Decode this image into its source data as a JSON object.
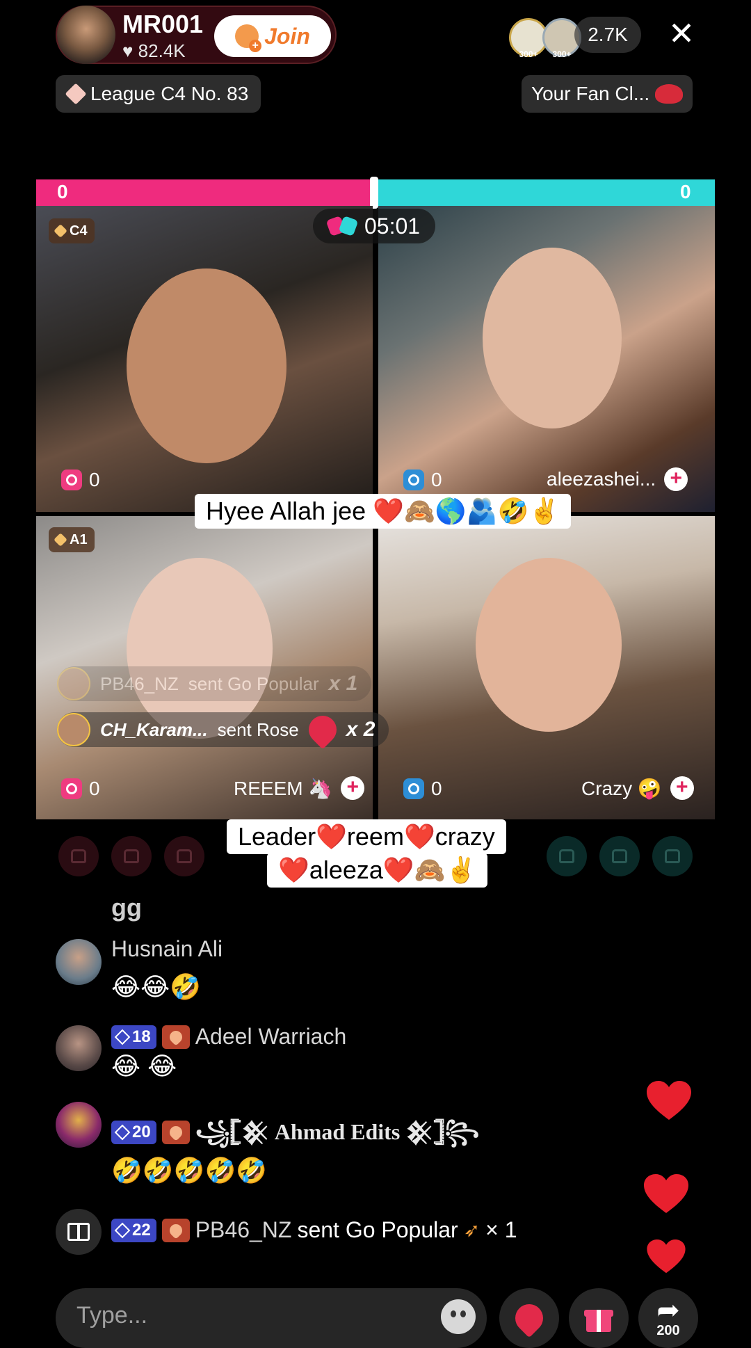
{
  "host": {
    "name": "MR001",
    "likes": "82.4K",
    "join_label": "Join"
  },
  "viewers": {
    "badge1": "300+",
    "badge2": "300+",
    "count": "2.7K"
  },
  "league": {
    "label": "League C4 No. 83"
  },
  "fan_club": {
    "label": "Your Fan Cl..."
  },
  "battle": {
    "score_left": "0",
    "score_right": "0",
    "timer": "05:01"
  },
  "tiles": [
    {
      "rank": "C4",
      "count": "0",
      "name": ""
    },
    {
      "rank": "",
      "count": "0",
      "name": "aleezashei..."
    },
    {
      "rank": "A1",
      "count": "0",
      "name": "REEEM 🦄"
    },
    {
      "rank": "",
      "count": "0",
      "name": "Crazy 🤪"
    }
  ],
  "gift_notes": [
    {
      "user": "PB46_NZ",
      "text": "sent Go Popular",
      "combo": "x 1"
    },
    {
      "user": "CH_Karam...",
      "text": "sent Rose",
      "combo": "x 2"
    }
  ],
  "captions": {
    "top": "Hyee Allah jee ❤️🙈🌎🫂🤣✌️",
    "middle_line1": "Leader❤️reem❤️crazy",
    "middle_line2": "❤️aleeza❤️🙈✌️"
  },
  "chat": {
    "partial": "gg",
    "messages": [
      {
        "name": "Husnain Ali",
        "text": "😂😂🤣"
      },
      {
        "level": "18",
        "name": "Adeel Warriach",
        "text": "😂 😂"
      },
      {
        "level": "20",
        "name": "꧁𓊈𒆜 Ahmad Edits 𒆜𓊉꧂",
        "text": "🤣🤣🤣🤣🤣"
      },
      {
        "level": "22",
        "name": "PB46_NZ",
        "text": "sent Go Popular",
        "combo": "× 1"
      }
    ]
  },
  "input": {
    "placeholder": "Type..."
  },
  "share": {
    "count": "200"
  },
  "colors": {
    "pink_team": "#ef2b7e",
    "teal_team": "#2fd7d8",
    "join": "#f07a2c",
    "heart": "#e8202e"
  }
}
